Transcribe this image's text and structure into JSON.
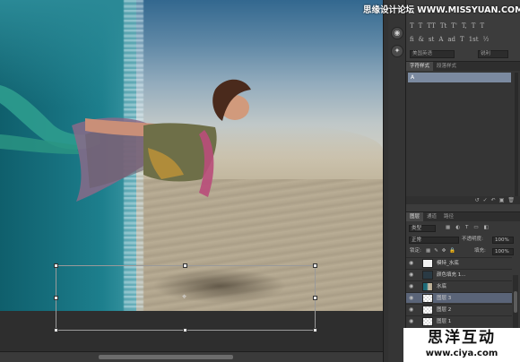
{
  "watermark_top": "思缘设计论坛 WWW.MISSYUAN.COM",
  "character_panel": {
    "glyph_row_1": [
      "T",
      "T",
      "TT",
      "Tt",
      "T'",
      "T,",
      "T",
      "T"
    ],
    "glyph_row_2": [
      "fi",
      "&",
      "st",
      "A",
      "ad",
      "T",
      "1st",
      "½"
    ],
    "language": "美国英语",
    "antialias": "锐利"
  },
  "char_style_panel": {
    "tabs": [
      "字符样式",
      "段落样式"
    ],
    "active_tab": 0,
    "selected_style": "A",
    "footer_icons": [
      "↺",
      "✓",
      "↶",
      "▣",
      "🗑"
    ]
  },
  "layers_panel": {
    "tabs": [
      "图层",
      "通道",
      "路径"
    ],
    "filter_kind": "类型",
    "filter_icons": [
      "▦",
      "◐",
      "T",
      "▭",
      "◧"
    ],
    "blend_mode": "正常",
    "opacity_label": "不透明度:",
    "opacity_value": "100%",
    "lock_label": "锁定:",
    "fill_label": "填充:",
    "fill_value": "100%",
    "layers": [
      {
        "name": "模特_水底",
        "thumb": "white",
        "selected": false
      },
      {
        "name": "颜色填充 1...",
        "thumb": "dark",
        "selected": false
      },
      {
        "name": "水底",
        "thumb": "photo",
        "selected": false
      },
      {
        "name": "图层 3",
        "thumb": "checker",
        "selected": true
      },
      {
        "name": "图层 2",
        "thumb": "checker",
        "selected": false
      },
      {
        "name": "图层 1",
        "thumb": "checker",
        "selected": false
      }
    ]
  },
  "watermark_bottom": {
    "title": "思洋互动",
    "url": "www.ciya.com"
  },
  "transform_pivot_glyph": "⌖"
}
